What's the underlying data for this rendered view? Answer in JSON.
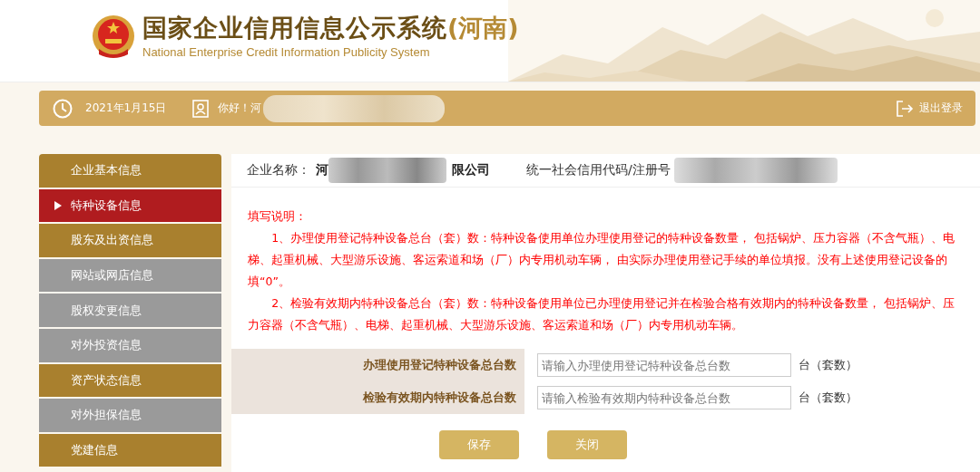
{
  "header": {
    "title": "国家企业信用信息公示系统",
    "region": "(河南)",
    "subtitle": "National Enterprise Credit Information Publicity System"
  },
  "top_bar": {
    "date": "2021年1月15日",
    "greeting": "你好！河",
    "logout": "退出登录"
  },
  "sidebar": {
    "items": [
      {
        "label": "企业基本信息",
        "selected": false,
        "color": "#a9802e"
      },
      {
        "label": "特种设备信息",
        "selected": true,
        "color": "#b01c1f"
      },
      {
        "label": "股东及出资信息",
        "selected": false,
        "color": "#a9802e"
      },
      {
        "label": "网站或网店信息",
        "selected": false,
        "color": "#9a9a9a"
      },
      {
        "label": "股权变更信息",
        "selected": false,
        "color": "#9a9a9a"
      },
      {
        "label": "对外投资信息",
        "selected": false,
        "color": "#9a9a9a"
      },
      {
        "label": "资产状态信息",
        "selected": false,
        "color": "#a9802e"
      },
      {
        "label": "对外担保信息",
        "selected": false,
        "color": "#9a9a9a"
      },
      {
        "label": "党建信息",
        "selected": false,
        "color": "#a9802e"
      }
    ]
  },
  "company": {
    "name_label": "企业名称：",
    "name_start": "河",
    "name_end": "限公司",
    "code_label": "统一社会信用代码/注册号"
  },
  "notes": {
    "title": "填写说明：",
    "paragraphs": [
      "1、办理使用登记特种设备总台（套）数：特种设备使用单位办理使用登记的特种设备数量， 包括锅炉、压力容器（不含气瓶）、电梯、起重机械、大型游乐设施、客运索道和场（厂）内专用机动车辆， 由实际办理使用登记手续的单位填报。没有上述使用登记设备的填“0”。",
      "2、检验有效期内特种设备总台（套）数：特种设备使用单位已办理使用登记并在检验合格有效期内的特种设备数量， 包括锅炉、压力容器（不含气瓶）、电梯、起重机械、大型游乐设施、客运索道和场（厂）内专用机动车辆。"
    ]
  },
  "form": {
    "rows": [
      {
        "label": "办理使用登记特种设备总台数",
        "placeholder": "请输入办理使用登记特种设备总台数",
        "unit": "台（套数）"
      },
      {
        "label": "检验有效期内特种设备总台数",
        "placeholder": "请输入检验有效期内特种设备总台数",
        "unit": "台（套数）"
      }
    ],
    "buttons": [
      "保存",
      "关闭"
    ]
  }
}
